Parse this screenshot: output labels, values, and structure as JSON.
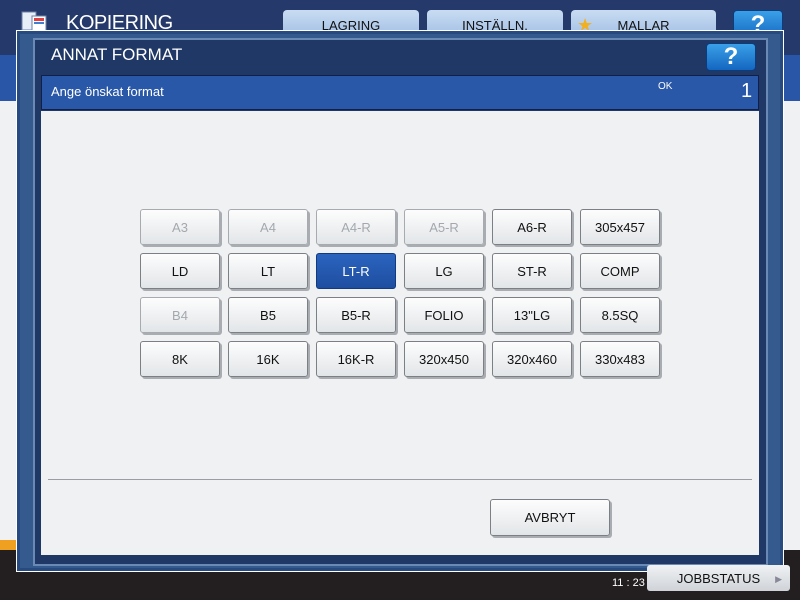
{
  "app": {
    "title": "KOPIERING",
    "tabs": [
      {
        "label": "LAGRING"
      },
      {
        "label": "INSTÄLLN."
      },
      {
        "label": "MALLAR",
        "icon": "star-icon"
      }
    ],
    "help_label": "?"
  },
  "dialog": {
    "title": "ANNAT FORMAT",
    "help_label": "?",
    "prompt": "Ange önskat format",
    "ok_label": "OK",
    "count": "1",
    "formats": [
      [
        {
          "label": "A3",
          "enabled": false
        },
        {
          "label": "A4",
          "enabled": false
        },
        {
          "label": "A4-R",
          "enabled": false
        },
        {
          "label": "A5-R",
          "enabled": false
        },
        {
          "label": "A6-R",
          "enabled": true
        },
        {
          "label": "305x457",
          "enabled": true
        }
      ],
      [
        {
          "label": "LD",
          "enabled": true
        },
        {
          "label": "LT",
          "enabled": true
        },
        {
          "label": "LT-R",
          "enabled": true,
          "selected": true
        },
        {
          "label": "LG",
          "enabled": true
        },
        {
          "label": "ST-R",
          "enabled": true
        },
        {
          "label": "COMP",
          "enabled": true
        }
      ],
      [
        {
          "label": "B4",
          "enabled": false
        },
        {
          "label": "B5",
          "enabled": true
        },
        {
          "label": "B5-R",
          "enabled": true
        },
        {
          "label": "FOLIO",
          "enabled": true
        },
        {
          "label": "13\"LG",
          "enabled": true
        },
        {
          "label": "8.5SQ",
          "enabled": true
        }
      ],
      [
        {
          "label": "8K",
          "enabled": true
        },
        {
          "label": "16K",
          "enabled": true
        },
        {
          "label": "16K-R",
          "enabled": true
        },
        {
          "label": "320x450",
          "enabled": true
        },
        {
          "label": "320x460",
          "enabled": true
        },
        {
          "label": "330x483",
          "enabled": true
        }
      ]
    ],
    "cancel_label": "AVBRYT"
  },
  "status": {
    "time": "11 : 23",
    "jobstatus_label": "JOBBSTATUS"
  },
  "colors": {
    "accent": "#2a58a8",
    "selected": "#2360b8",
    "frame": "#203866"
  }
}
